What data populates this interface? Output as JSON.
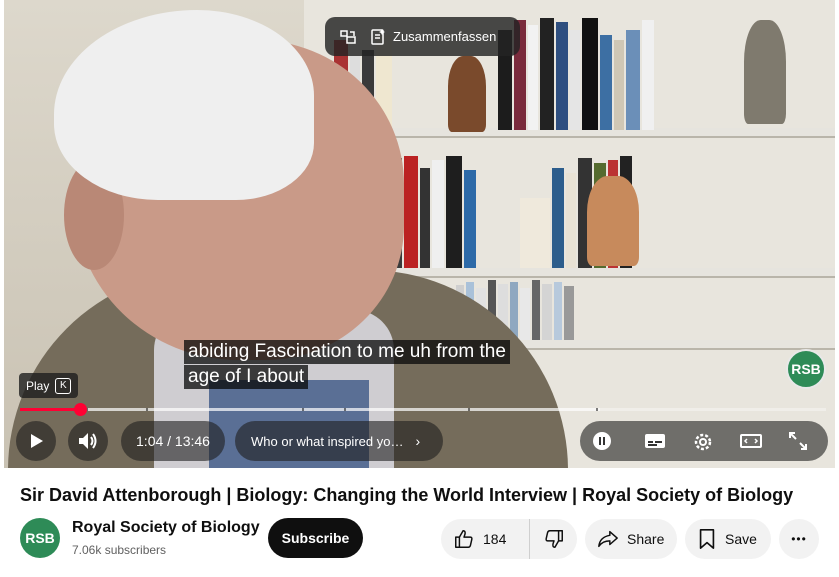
{
  "player": {
    "summarize_label": "Zusammenfassen",
    "captions": [
      "abiding Fascination to me uh from the",
      "age of I about"
    ],
    "play_tooltip": {
      "label": "Play",
      "shortcut": "K"
    },
    "watermark": "RSB",
    "progress": {
      "played_fraction": 0.074,
      "loaded_fraction": 0.72
    },
    "time_display": "1:04 / 13:46",
    "chapter_label": "Who or what inspired yo…",
    "chapter_chevron": "›",
    "accent_color": "#ff0033"
  },
  "video": {
    "title": "Sir David Attenborough | Biology: Changing the World Interview | Royal Society of Biology"
  },
  "channel": {
    "avatar_text": "RSB",
    "name": "Royal Society of Biology",
    "subscribers": "7.06k subscribers",
    "avatar_color": "#2e8b57"
  },
  "actions": {
    "subscribe_label": "Subscribe",
    "like_count": "184",
    "share_label": "Share",
    "save_label": "Save",
    "more_label": "•••"
  },
  "icons": {
    "player_top": [
      "miniplayer-icon",
      "summarize-icon"
    ],
    "player_left": [
      "play-icon",
      "volume-icon"
    ],
    "player_right": [
      "pause-icon",
      "subtitles-icon",
      "settings-icon",
      "theater-icon",
      "fullscreen-icon"
    ],
    "actions": [
      "thumbs-up-icon",
      "thumbs-down-icon",
      "share-icon",
      "bookmark-icon",
      "more-icon"
    ]
  }
}
